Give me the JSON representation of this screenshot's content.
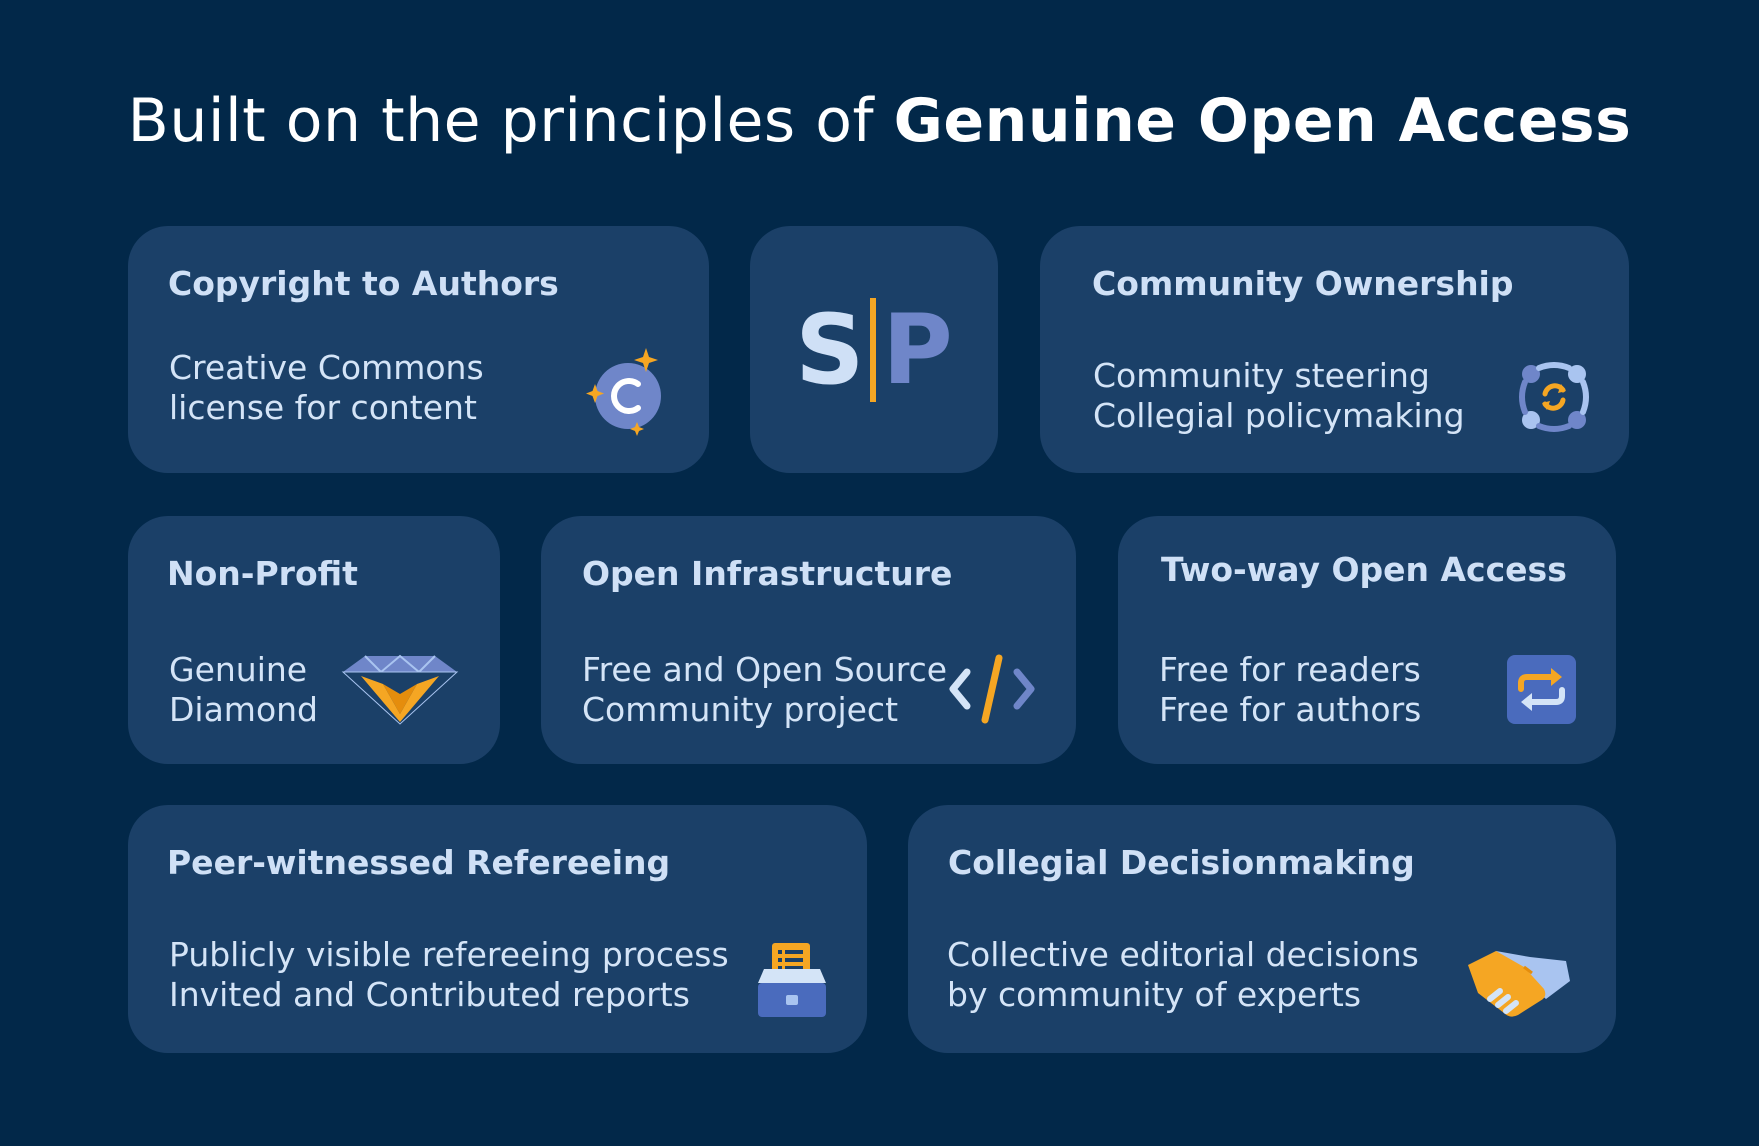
{
  "title": {
    "normal": "Built on the principles of ",
    "bold": "Genuine Open Access"
  },
  "logo": {
    "left": "S",
    "right": "P"
  },
  "cards": [
    {
      "heading": "Copyright to Authors",
      "line1": "Creative Commons",
      "line2": "license for content",
      "icon": "creative-commons-icon"
    },
    {
      "heading": "Community Ownership",
      "line1": "Community steering",
      "line2": "Collegial policymaking",
      "icon": "community-cycle-icon"
    },
    {
      "heading": "Non-Profit",
      "line1": "Genuine",
      "line2": "Diamond",
      "icon": "diamond-icon"
    },
    {
      "heading": "Open Infrastructure",
      "line1": "Free and Open Source",
      "line2": "Community project",
      "icon": "code-icon"
    },
    {
      "heading": "Two-way Open Access",
      "line1": "Free for readers",
      "line2": "Free for authors",
      "icon": "exchange-arrows-icon"
    },
    {
      "heading": "Peer-witnessed Refereeing",
      "line1": "Publicly visible refereeing process",
      "line2": "Invited and Contributed reports",
      "icon": "ballot-box-icon"
    },
    {
      "heading": "Collegial Decisionmaking",
      "line1": "Collective editorial decisions",
      "line2": "by community of experts",
      "icon": "handshake-icon"
    }
  ],
  "colors": {
    "background": "#022849",
    "card": "#1b4068",
    "accent_orange": "#f5a623",
    "accent_blue": "#6f86c9"
  }
}
